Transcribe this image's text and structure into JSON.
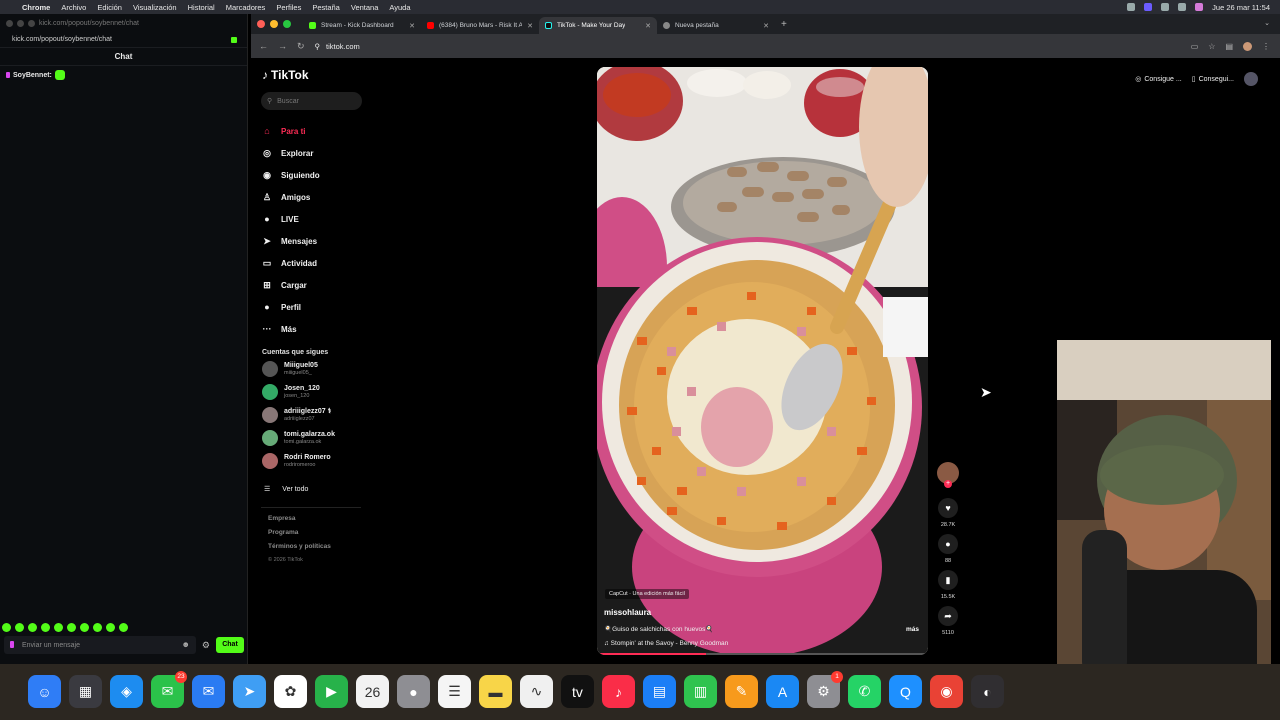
{
  "menubar": {
    "app": "Chrome",
    "items": [
      "Archivo",
      "Edición",
      "Visualización",
      "Historial",
      "Marcadores",
      "Perfiles",
      "Pestaña",
      "Ventana",
      "Ayuda"
    ],
    "clock": "Jue 26 mar 11:54"
  },
  "kick": {
    "window_title": "kick.com/popout/soybennet/chat",
    "url": "kick.com/popout/soybennet/chat",
    "chat_header": "Chat",
    "message_user": "SoyBennet:",
    "input_placeholder": "Enviar un mensaje",
    "send_button": "Chat"
  },
  "chrome": {
    "tabs": [
      {
        "title": "Stream - Kick Dashboard",
        "color": "#53fc18"
      },
      {
        "title": "(6384) Bruno Mars - Risk It A",
        "color": "#ff0000"
      },
      {
        "title": "TikTok - Make Your Day",
        "color": "#111111"
      },
      {
        "title": "Nueva pestaña",
        "color": "#888888"
      }
    ],
    "url": "tiktok.com"
  },
  "tiktok": {
    "brand": "TikTok",
    "search_placeholder": "Buscar",
    "nav": [
      {
        "label": "Para ti",
        "icon": "home-icon",
        "glyph": "⌂"
      },
      {
        "label": "Explorar",
        "icon": "compass-icon",
        "glyph": "◎"
      },
      {
        "label": "Siguiendo",
        "icon": "following-icon",
        "glyph": "◉"
      },
      {
        "label": "Amigos",
        "icon": "friends-icon",
        "glyph": "♙"
      },
      {
        "label": "LIVE",
        "icon": "live-icon",
        "glyph": "●"
      },
      {
        "label": "Mensajes",
        "icon": "messages-icon",
        "glyph": "➤"
      },
      {
        "label": "Actividad",
        "icon": "activity-icon",
        "glyph": "▭"
      },
      {
        "label": "Cargar",
        "icon": "upload-icon",
        "glyph": "⊞"
      },
      {
        "label": "Perfil",
        "icon": "profile-icon",
        "glyph": "●"
      },
      {
        "label": "Más",
        "icon": "more-icon",
        "glyph": "···"
      }
    ],
    "following_header": "Cuentas que sigues",
    "accounts": [
      {
        "name": "Miiiguel05",
        "handle": "miiiguel05_"
      },
      {
        "name": "Josen_120",
        "handle": "josen_120"
      },
      {
        "name": "adriiiglezz07 ⚕",
        "handle": "adriiiglezz07"
      },
      {
        "name": "tomi.galarza.ok",
        "handle": "tomi.galarza.ok"
      },
      {
        "name": "Rodri Romero",
        "handle": "rodriromeroo"
      }
    ],
    "see_all": "Ver todo",
    "footer_links": [
      "Empresa",
      "Programa",
      "Términos y políticas"
    ],
    "copyright": "© 2026 TikTok",
    "top_buttons": [
      "Consigue ...",
      "Consegui..."
    ],
    "video": {
      "capcut_label": "CapCut · Una edición más fácil",
      "author": "missohlaura",
      "description": "🍳Guiso de salchichas con huevos🍳",
      "more": "más",
      "song": "♫ Stompin' at the Savoy - Benny Goodman",
      "progress": 0.33
    },
    "stats": {
      "likes": "28.7K",
      "comments": "88",
      "saves": "15.5K",
      "shares": "5110"
    }
  },
  "dock": {
    "apps": [
      {
        "name": "finder",
        "color": "#2f7df6",
        "glyph": "☺"
      },
      {
        "name": "launchpad",
        "color": "#3a3a40",
        "glyph": "▦"
      },
      {
        "name": "safari",
        "color": "#1d8cf0",
        "glyph": "◈"
      },
      {
        "name": "messages",
        "color": "#2bc24a",
        "glyph": "✉",
        "badge": "23"
      },
      {
        "name": "mail",
        "color": "#2a7bf2",
        "glyph": "✉"
      },
      {
        "name": "maps",
        "color": "#3f9ef4",
        "glyph": "➤"
      },
      {
        "name": "photos",
        "color": "#ffffff",
        "glyph": "✿"
      },
      {
        "name": "facetime",
        "color": "#27b24a",
        "glyph": "▶"
      },
      {
        "name": "calendar",
        "color": "#f2f2f2",
        "glyph": "26"
      },
      {
        "name": "contacts",
        "color": "#8e8e93",
        "glyph": "●"
      },
      {
        "name": "reminders",
        "color": "#f5f5f5",
        "glyph": "☰"
      },
      {
        "name": "notes",
        "color": "#f8d548",
        "glyph": "▬"
      },
      {
        "name": "freeform",
        "color": "#f0f0f0",
        "glyph": "∿"
      },
      {
        "name": "tv",
        "color": "#111111",
        "glyph": "tv"
      },
      {
        "name": "music",
        "color": "#fa2d48",
        "glyph": "♪"
      },
      {
        "name": "keynote",
        "color": "#1b7ef6",
        "glyph": "▤"
      },
      {
        "name": "numbers",
        "color": "#2fc34f",
        "glyph": "▥"
      },
      {
        "name": "pages",
        "color": "#f79a1c",
        "glyph": "✎"
      },
      {
        "name": "app-store",
        "color": "#1a88f4",
        "glyph": "A"
      },
      {
        "name": "system-settings",
        "color": "#8e8e93",
        "glyph": "⚙",
        "badge": "1"
      },
      {
        "name": "whatsapp",
        "color": "#25d366",
        "glyph": "✆"
      },
      {
        "name": "quicktime",
        "color": "#1e90ff",
        "glyph": "Q"
      },
      {
        "name": "chrome",
        "color": "#e94235",
        "glyph": "◉"
      },
      {
        "name": "obs",
        "color": "#302e31",
        "glyph": "◐"
      }
    ]
  },
  "colors": {
    "tiktok_accent": "#fe2c55",
    "kick_green": "#53fc18"
  }
}
